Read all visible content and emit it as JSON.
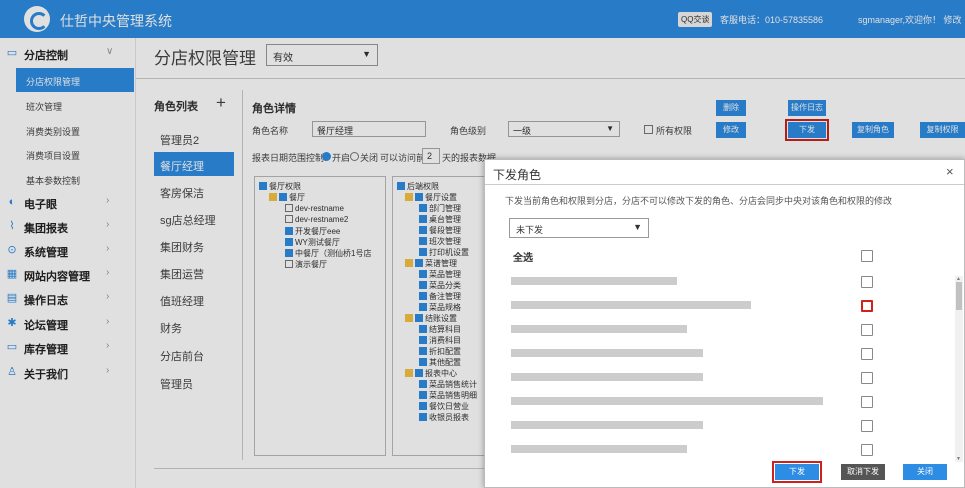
{
  "header": {
    "app_title": "仕哲中央管理系统",
    "qq_label": "QQ交谈",
    "hotline": "客服电话：010-57835586",
    "user": "sgmanager,欢迎你！ 修改"
  },
  "colors": {
    "primary": "#2d8ce3",
    "highlight": "#d0211b"
  },
  "sidebar": {
    "groups": [
      {
        "label": "分店控制",
        "icon": "store-icon",
        "expanded": true,
        "items": [
          {
            "label": "分店权限管理",
            "active": true
          },
          {
            "label": "班次管理"
          },
          {
            "label": "消费类别设置"
          },
          {
            "label": "消费项目设置"
          },
          {
            "label": "基本参数控制"
          }
        ]
      },
      {
        "label": "电子眼",
        "icon": "eye-icon"
      },
      {
        "label": "集团报表",
        "icon": "chart-icon"
      },
      {
        "label": "系统管理",
        "icon": "settings-icon"
      },
      {
        "label": "网站内容管理",
        "icon": "grid-icon"
      },
      {
        "label": "操作日志",
        "icon": "log-icon"
      },
      {
        "label": "论坛管理",
        "icon": "forum-icon"
      },
      {
        "label": "库存管理",
        "icon": "inventory-icon"
      },
      {
        "label": "关于我们",
        "icon": "user-icon"
      }
    ]
  },
  "page": {
    "title": "分店权限管理",
    "status_select": "有效",
    "role_list_title": "角色列表",
    "roles": [
      "管理员2",
      "餐厅经理",
      "客房保洁",
      "sg店总经理",
      "集团财务",
      "集团运营",
      "值班经理",
      "财务",
      "分店前台",
      "管理员"
    ],
    "active_role": "餐厅经理",
    "detail_title": "角色详情",
    "role_name_label": "角色名称",
    "role_name_value": "餐厅经理",
    "role_level_label": "角色级别",
    "role_level_value": "一级",
    "all_perm_label": "所有权限",
    "report_ctrl": "报表日期范围控制:",
    "radio_on": "开启",
    "radio_off": "关闭",
    "report_days_prefix": "可以访问前",
    "report_days_value": "2",
    "report_days_suffix": "天的报表数据",
    "buttons": {
      "delete": "删除",
      "oplog": "操作日志",
      "edit": "修改",
      "distribute": "下发",
      "copy_role": "复制角色",
      "copy_perm": "复制权限"
    },
    "tree_left": {
      "root": "餐厅权限",
      "group": "餐厅",
      "items": [
        {
          "label": "dev-restname",
          "checked": false
        },
        {
          "label": "dev-restname2",
          "checked": false
        },
        {
          "label": "开发餐厅eee",
          "checked": true
        },
        {
          "label": "WY测试餐厅",
          "checked": true
        },
        {
          "label": "中餐厅（测仙桥1号店",
          "checked": true
        },
        {
          "label": "演示餐厅",
          "checked": false
        }
      ]
    },
    "tree_right": {
      "root": "后端权限",
      "groups": [
        {
          "label": "餐厅设置",
          "items": [
            "部门管理",
            "桌台管理",
            "餐段管理",
            "班次管理",
            "打印机设置"
          ]
        },
        {
          "label": "菜谱管理",
          "items": [
            "菜品管理",
            "菜品分类",
            "备注管理",
            "菜品规格"
          ]
        },
        {
          "label": "结账设置",
          "items": [
            "结算科目",
            "消费科目",
            "折扣配置",
            "其他配置"
          ]
        },
        {
          "label": "报表中心",
          "items": [
            "菜品销售统计",
            "菜品销售明细",
            "餐饮日营业",
            "收银员报表"
          ]
        }
      ]
    }
  },
  "dialog": {
    "title": "下发角色",
    "close": "×",
    "note": "下发当前角色和权限到分店，分店不可以修改下发的角色、分店会同步中央对该角色和权限的修改",
    "filter_select": "未下发",
    "select_all": "全选",
    "rows": [
      {
        "checked": false
      },
      {
        "checked": false,
        "highlighted": true
      },
      {
        "checked": false
      },
      {
        "checked": false
      },
      {
        "checked": false
      },
      {
        "checked": false
      },
      {
        "checked": false
      },
      {
        "checked": false
      }
    ],
    "buttons": {
      "distribute": "下发",
      "cancel": "取消下发",
      "close": "关闭"
    }
  }
}
